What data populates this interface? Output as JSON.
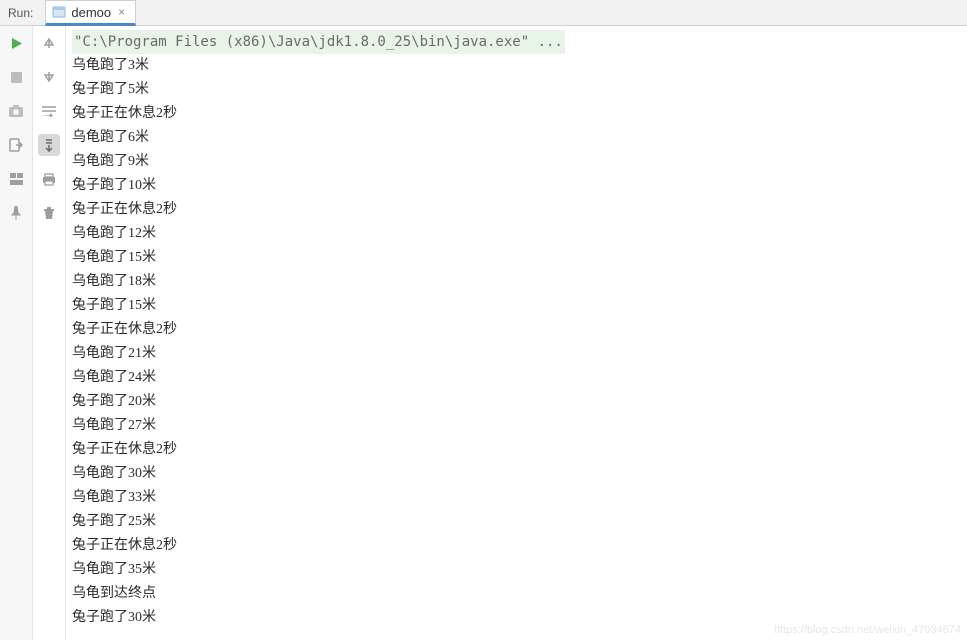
{
  "header": {
    "run_label": "Run:",
    "tab_name": "demoo",
    "tab_close": "×"
  },
  "console": {
    "command": "\"C:\\Program Files (x86)\\Java\\jdk1.8.0_25\\bin\\java.exe\" ...",
    "lines": [
      "乌龟跑了3米",
      "兔子跑了5米",
      "兔子正在休息2秒",
      "乌龟跑了6米",
      "乌龟跑了9米",
      "兔子跑了10米",
      "兔子正在休息2秒",
      "乌龟跑了12米",
      "乌龟跑了15米",
      "乌龟跑了18米",
      "兔子跑了15米",
      "兔子正在休息2秒",
      "乌龟跑了21米",
      "乌龟跑了24米",
      "兔子跑了20米",
      "乌龟跑了27米",
      "兔子正在休息2秒",
      "乌龟跑了30米",
      "乌龟跑了33米",
      "兔子跑了25米",
      "兔子正在休息2秒",
      "乌龟跑了35米",
      "乌龟到达终点",
      "兔子跑了30米"
    ]
  },
  "watermark": "https://blog.csdn.net/weixin_47034674"
}
